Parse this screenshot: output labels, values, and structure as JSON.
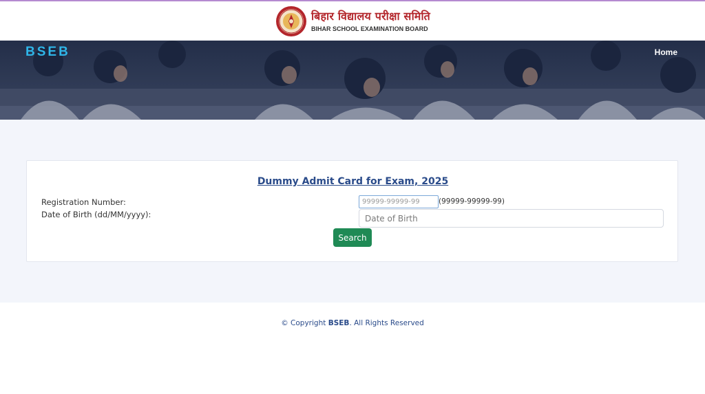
{
  "header": {
    "org_hindi": "बिहार विद्यालय परीक्षा समिति",
    "org_english": "BIHAR SCHOOL EXAMINATION BOARD"
  },
  "nav": {
    "brand": "BSEB",
    "home_label": "Home"
  },
  "form": {
    "title": "Dummy Admit Card for Exam, 2025",
    "registration_label": "Registration Number:",
    "registration_placeholder": "99999-99999-99",
    "registration_value": "",
    "registration_hint": "(99999-99999-99)",
    "dob_label": "Date of Birth (dd/MM/yyyy):",
    "dob_placeholder": "Date of Birth",
    "dob_value": "",
    "search_label": "Search"
  },
  "footer": {
    "prefix": "© Copyright ",
    "brand": "BSEB",
    "suffix": ". All Rights Reserved"
  },
  "colors": {
    "brand_blue": "#2fb5e8",
    "title_blue": "#2a4b8a",
    "button_green": "#1f8a55",
    "logo_red": "#b3262b"
  }
}
